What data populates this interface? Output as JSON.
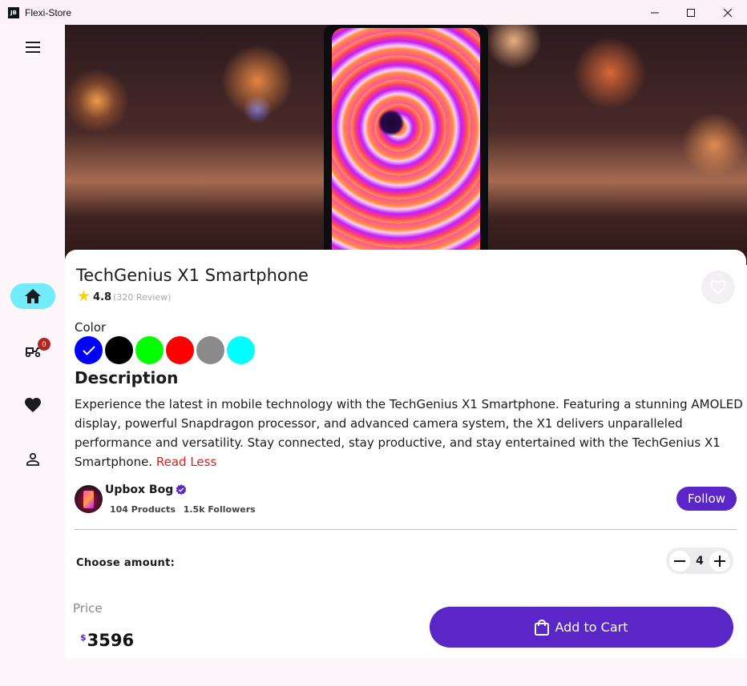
{
  "window": {
    "icon_text": "JB",
    "title": "Flexi-Store"
  },
  "rail": {
    "items": [
      {
        "name": "home",
        "active": true
      },
      {
        "name": "cart",
        "badge": "0"
      },
      {
        "name": "favorites"
      },
      {
        "name": "profile"
      }
    ]
  },
  "product": {
    "title": "TechGenius X1 Smartphone",
    "rating": "4.8",
    "reviews": "(320 Review)",
    "color_label": "Color",
    "colors": [
      "#0000ff",
      "#000000",
      "#00ff00",
      "#ff0000",
      "#8a8a8a",
      "#00ffff"
    ],
    "selected_color": "#0000ff",
    "description_title": "Description",
    "description": "Experience the latest in mobile technology with the TechGenius X1 Smartphone. Featuring a stunning AMOLED display, powerful Snapdragon processor, and advanced camera system, the X1 delivers unparalleled performance and versatility. Stay connected, stay productive, and stay entertained with the TechGenius X1 Smartphone.",
    "read_toggle": "Read Less"
  },
  "seller": {
    "name": "Upbox Bog",
    "products": "104 Products",
    "followers": "1.5k Followers",
    "follow_label": "Follow"
  },
  "amount": {
    "label": "Choose amount:",
    "quantity": "4"
  },
  "price": {
    "label": "Price",
    "currency": "$",
    "value": "3596"
  },
  "cart_button": {
    "label": "Add to Cart"
  },
  "colors": {
    "accent": "#5a26c8",
    "rail_active": "#72ecfb",
    "badge": "#b3261e",
    "read_toggle": "#d32020"
  }
}
